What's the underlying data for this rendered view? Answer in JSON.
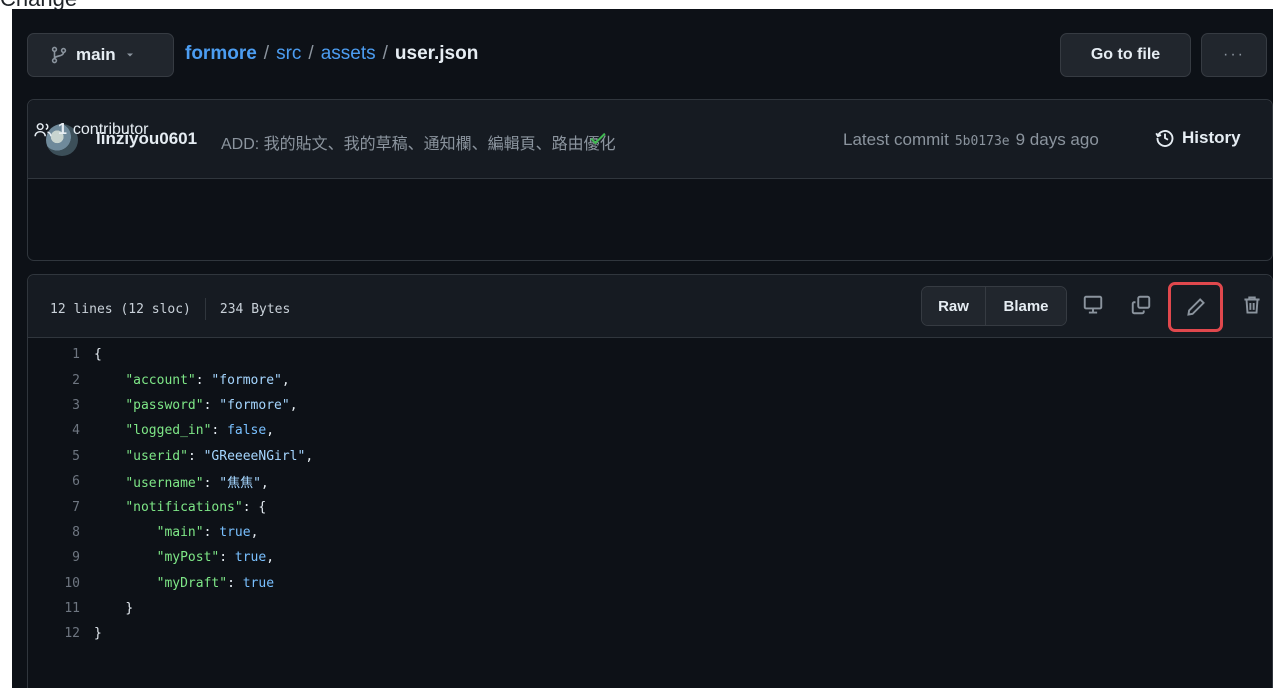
{
  "top_fragment": "Change",
  "branch": {
    "label": "main",
    "icon": "git-branch-icon"
  },
  "breadcrumb": {
    "repo": "formore",
    "segments": [
      "src",
      "assets"
    ],
    "separator": "/",
    "file": "user.json"
  },
  "header_buttons": {
    "go_to_file": "Go to file",
    "more": "···"
  },
  "commit": {
    "author": "linziyou0601",
    "message": "ADD: 我的貼文、我的草稿、通知欄、編輯頁、路由優化",
    "status": "success",
    "latest_label": "Latest commit",
    "sha": "5b0173e",
    "time": "9 days ago",
    "history_label": "History"
  },
  "contributors": {
    "count": "1",
    "label": "contributor"
  },
  "file": {
    "lines_info": "12 lines (12 sloc)",
    "size": "234 Bytes",
    "raw_label": "Raw",
    "blame_label": "Blame"
  },
  "code_lines": [
    {
      "n": "1",
      "indent": "",
      "key": "",
      "value": "",
      "value_type": "",
      "text": "{"
    },
    {
      "n": "2",
      "indent": "    ",
      "key": "\"account\"",
      "value": "\"formore\"",
      "value_type": "str",
      "text": ","
    },
    {
      "n": "3",
      "indent": "    ",
      "key": "\"password\"",
      "value": "\"formore\"",
      "value_type": "str",
      "text": ","
    },
    {
      "n": "4",
      "indent": "    ",
      "key": "\"logged_in\"",
      "value": "false",
      "value_type": "kw",
      "text": ","
    },
    {
      "n": "5",
      "indent": "    ",
      "key": "\"userid\"",
      "value": "\"GReeeeNGirl\"",
      "value_type": "str",
      "text": ","
    },
    {
      "n": "6",
      "indent": "    ",
      "key": "\"username\"",
      "value": "\"焦焦\"",
      "value_type": "str",
      "text": ","
    },
    {
      "n": "7",
      "indent": "    ",
      "key": "\"notifications\"",
      "value": "",
      "value_type": "",
      "text": ": {"
    },
    {
      "n": "8",
      "indent": "        ",
      "key": "\"main\"",
      "value": "true",
      "value_type": "kw",
      "text": ","
    },
    {
      "n": "9",
      "indent": "        ",
      "key": "\"myPost\"",
      "value": "true",
      "value_type": "kw",
      "text": ","
    },
    {
      "n": "10",
      "indent": "        ",
      "key": "\"myDraft\"",
      "value": "true",
      "value_type": "kw",
      "text": ""
    },
    {
      "n": "11",
      "indent": "    ",
      "key": "",
      "value": "",
      "value_type": "",
      "text": "}"
    },
    {
      "n": "12",
      "indent": "",
      "key": "",
      "value": "",
      "value_type": "",
      "text": "}"
    }
  ],
  "colors": {
    "background": "#0d1117",
    "link": "#4c9df1",
    "json_key": "#7ee787",
    "json_string": "#a5d6ff",
    "json_keyword": "#79c0ff",
    "success": "#3fb950",
    "highlight": "#e0484d"
  }
}
